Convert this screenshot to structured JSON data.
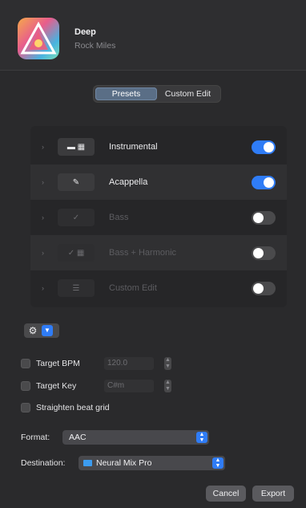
{
  "track": {
    "title": "Deep",
    "artist": "Rock Miles"
  },
  "mode_tabs": [
    "Presets",
    "Custom Edit"
  ],
  "presets": [
    {
      "icon": "drums-piano-icon",
      "glyph": "▬ ▦",
      "label": "Instrumental",
      "enabled": true
    },
    {
      "icon": "mic-icon",
      "glyph": "✎",
      "label": "Acappella",
      "enabled": true
    },
    {
      "icon": "guitar-icon",
      "glyph": "✓",
      "label": "Bass",
      "enabled": false
    },
    {
      "icon": "keys-icon",
      "glyph": "✓ ▦",
      "label": "Bass + Harmonic",
      "enabled": false
    },
    {
      "icon": "custom-icon",
      "glyph": "☰",
      "label": "Custom Edit",
      "enabled": false
    }
  ],
  "options": {
    "target_bpm_label": "Target BPM",
    "target_bpm_value": "120.0",
    "target_key_label": "Target Key",
    "target_key_value": "C#m",
    "straighten_label": "Straighten beat grid"
  },
  "format": {
    "label": "Format:",
    "value": "AAC"
  },
  "destination": {
    "label": "Destination:",
    "value": "Neural Mix Pro"
  },
  "buttons": {
    "cancel": "Cancel",
    "export": "Export"
  },
  "colors": {
    "accent": "#2f7cf6",
    "background": "#2a2a2c"
  }
}
